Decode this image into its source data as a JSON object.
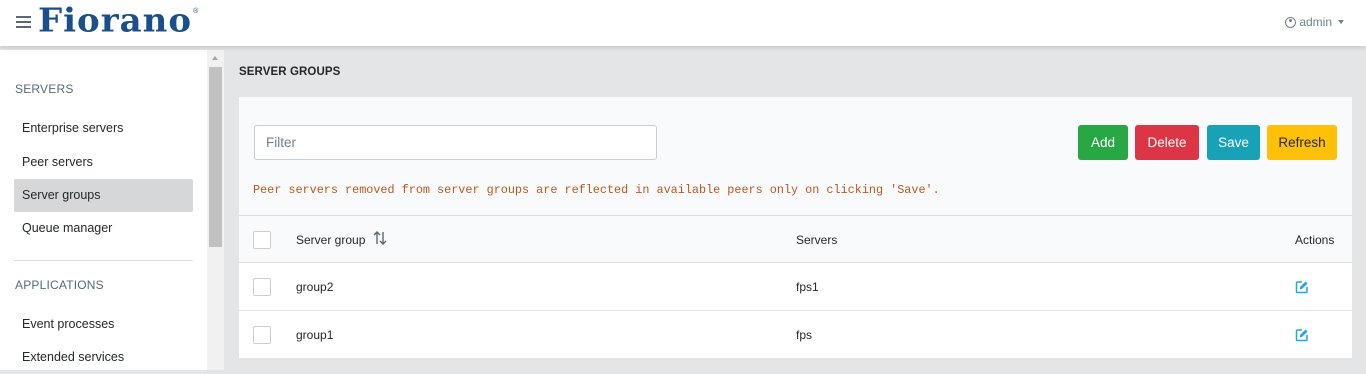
{
  "header": {
    "logo_text": "Fiorano",
    "logo_reg": "®",
    "user_label": "admin"
  },
  "sidebar": {
    "sections": [
      {
        "title": "SERVERS",
        "items": [
          {
            "label": "Enterprise servers",
            "active": false
          },
          {
            "label": "Peer servers",
            "active": false
          },
          {
            "label": "Server groups",
            "active": true
          },
          {
            "label": "Queue manager",
            "active": false
          }
        ]
      },
      {
        "title": "APPLICATIONS",
        "items": [
          {
            "label": "Event processes",
            "active": false
          },
          {
            "label": "Extended services",
            "active": false
          }
        ]
      }
    ]
  },
  "main": {
    "title": "SERVER GROUPS",
    "filter_placeholder": "Filter",
    "buttons": {
      "add": "Add",
      "delete": "Delete",
      "save": "Save",
      "refresh": "Refresh"
    },
    "notice": "Peer servers removed from server groups are reflected in available peers only on clicking 'Save'.",
    "table": {
      "columns": [
        "Server group",
        "Servers",
        "Actions"
      ],
      "rows": [
        {
          "group": "group2",
          "servers": "fps1"
        },
        {
          "group": "group1",
          "servers": "fps"
        }
      ]
    }
  },
  "colors": {
    "brand": "#1b4f8a",
    "add": "#28a745",
    "delete": "#dc3545",
    "save": "#17a2b8",
    "refresh": "#ffc107",
    "notice": "#c0571d",
    "edit_icon": "#20a8d8"
  }
}
